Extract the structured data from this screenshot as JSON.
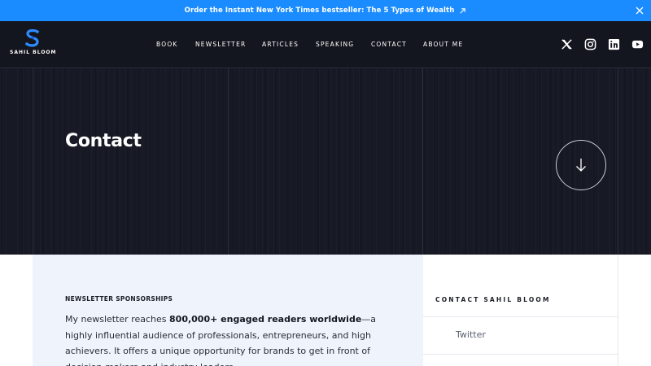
{
  "announcement": {
    "text": "Order the Instant New York Times bestseller: The 5 Types of Wealth"
  },
  "brand": {
    "name": "SAHIL BLOOM"
  },
  "nav": {
    "items": [
      "BOOK",
      "NEWSLETTER",
      "ARTICLES",
      "SPEAKING",
      "CONTACT",
      "ABOUT ME"
    ]
  },
  "social": [
    "x-icon",
    "instagram-icon",
    "linkedin-icon",
    "youtube-icon"
  ],
  "hero": {
    "title": "Contact"
  },
  "sponsorship": {
    "label": "NEWSLETTER SPONSORSHIPS",
    "text_before": "My newsletter reaches ",
    "text_bold": "800,000+ engaged readers worldwide",
    "text_after": "—a highly influential audience of professionals, entrepreneurs, and high achievers. It offers a unique opportunity for brands to get in front of decision-makers and industry leaders."
  },
  "contact_panel": {
    "heading": "CONTACT SAHIL BLOOM",
    "links": [
      "Twitter"
    ]
  },
  "colors": {
    "accent": "#1a8cff",
    "dark": "#14161f",
    "panel": "#eef3fc"
  }
}
